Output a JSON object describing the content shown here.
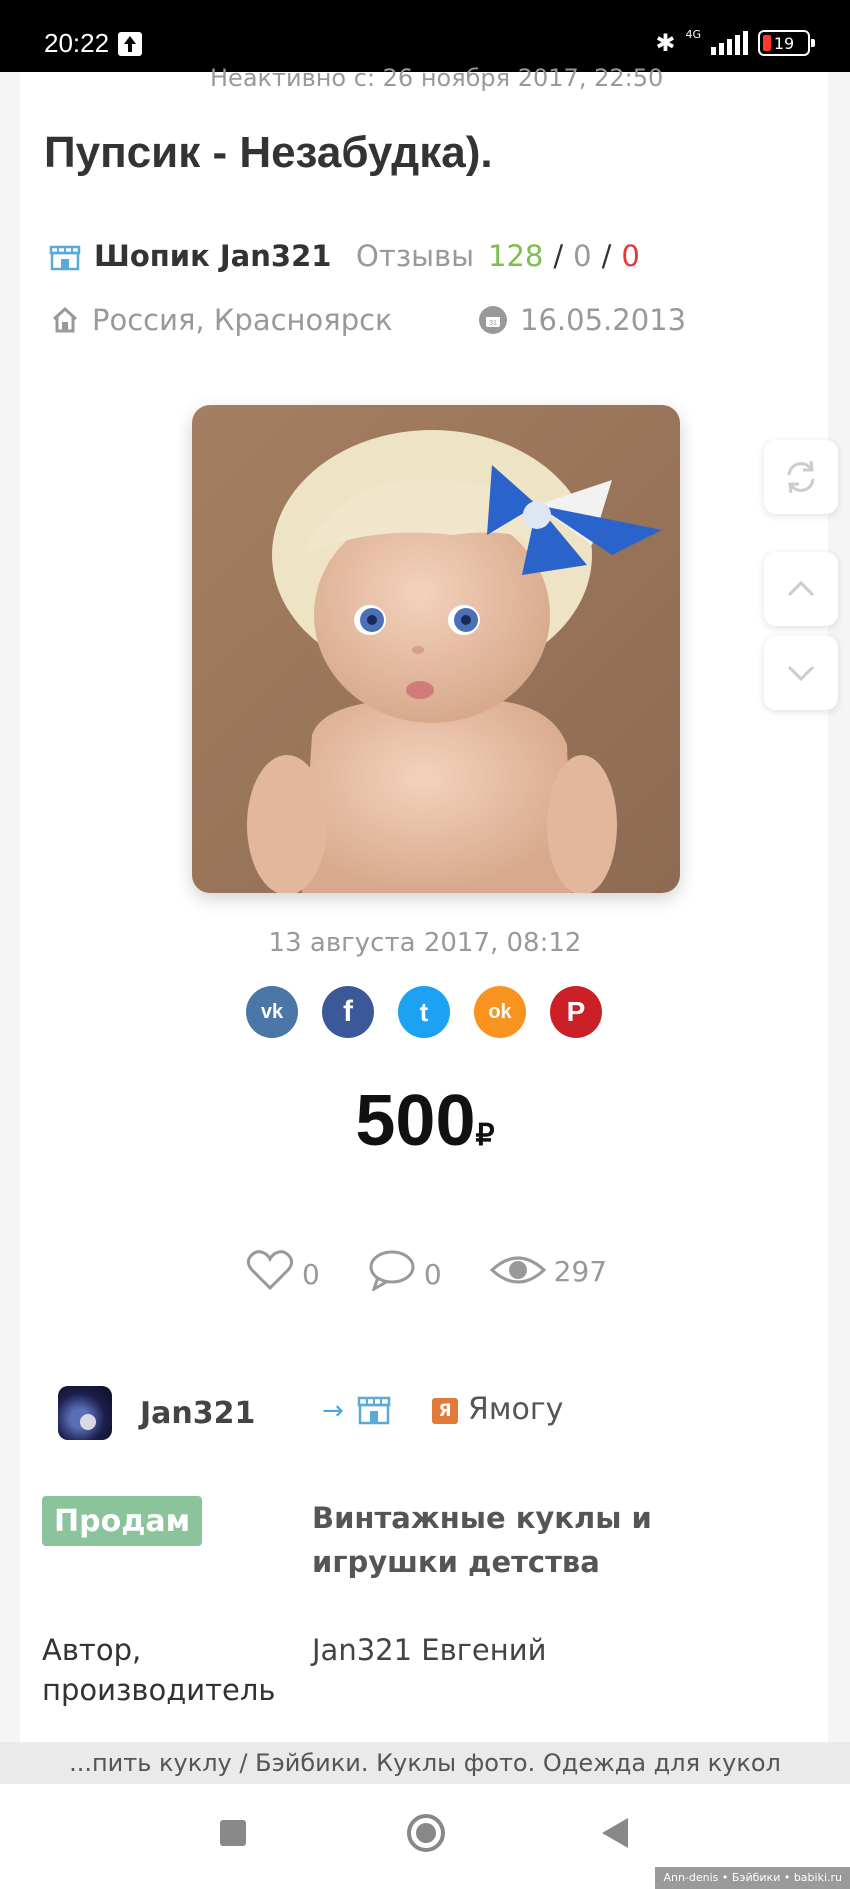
{
  "status_bar": {
    "time": "20:22",
    "network": "4G",
    "battery": "19"
  },
  "listing": {
    "inactive_since": "Неактивно с: 26 ноября 2017, 22:50",
    "title": "Пупсик - Незабудка).",
    "shop_name": "Шопик Jan321",
    "reviews_label": "Отзывы",
    "reviews_positive": "128",
    "reviews_neutral": "0",
    "reviews_negative": "0",
    "reviews_sep": "/",
    "location": "Россия, Красноярск",
    "date": "16.05.2013",
    "photo_date": "13 августа 2017, 08:12",
    "price": "500",
    "currency": "₽",
    "likes": "0",
    "comments": "0",
    "views": "297"
  },
  "share": [
    {
      "name": "vk",
      "label": "vk",
      "color": "#4a76a8"
    },
    {
      "name": "facebook",
      "label": "f",
      "color": "#3b5998"
    },
    {
      "name": "twitter",
      "label": "t",
      "color": "#1da1f2"
    },
    {
      "name": "odnoklassniki",
      "label": "ok",
      "color": "#f7931e"
    },
    {
      "name": "pinterest",
      "label": "P",
      "color": "#cb2027"
    }
  ],
  "author": {
    "name": "Jan321",
    "arrow": "→",
    "shop_logo": "Я",
    "shop": "Ямогу"
  },
  "details": {
    "badge": "Продам",
    "category": "Винтажные куклы и игрушки детства",
    "author_label": "Автор, производитель",
    "author_value": "Jan321 Евгений"
  },
  "browser": {
    "url_text": "...пить куклу / Бэйбики. Куклы фото. Одежда для кукол"
  },
  "watermark": "Ann-denis • Бэйбики • babiki.ru"
}
